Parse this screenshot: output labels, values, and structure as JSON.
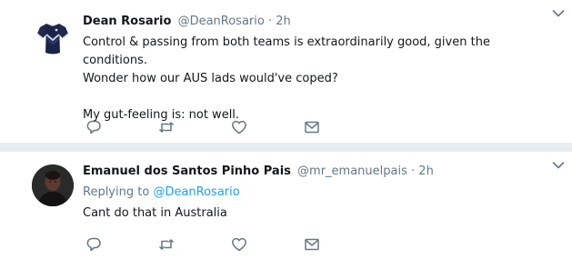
{
  "tweets": [
    {
      "fullname": "Dean Rosario",
      "username": "@DeanRosario",
      "separator": "·",
      "time": "2h",
      "text_lines": [
        "Control & passing from both teams is extraordinarily good, given the conditions.",
        "Wonder how our AUS lads would've coped?"
      ],
      "text_lines_2": [
        "My gut-feeling is: not well."
      ],
      "avatar": "jersey-avatar-icon"
    },
    {
      "fullname": "Emanuel dos Santos Pinho Pais",
      "username": "@mr_emanuelpais",
      "separator": "·",
      "time": "2h",
      "replying_prefix": "Replying to",
      "replying_to": "@DeanRosario",
      "text": "Cant do that in Australia",
      "avatar": "profile-photo-avatar"
    }
  ],
  "icons": {
    "caret": "chevron-down-icon",
    "reply": "reply-icon",
    "retweet": "retweet-icon",
    "like": "heart-icon",
    "dm": "envelope-icon"
  },
  "colors": {
    "background": "#e6ecf0",
    "card": "#ffffff",
    "text": "#14171a",
    "muted": "#657786",
    "link": "#1da1f2"
  }
}
